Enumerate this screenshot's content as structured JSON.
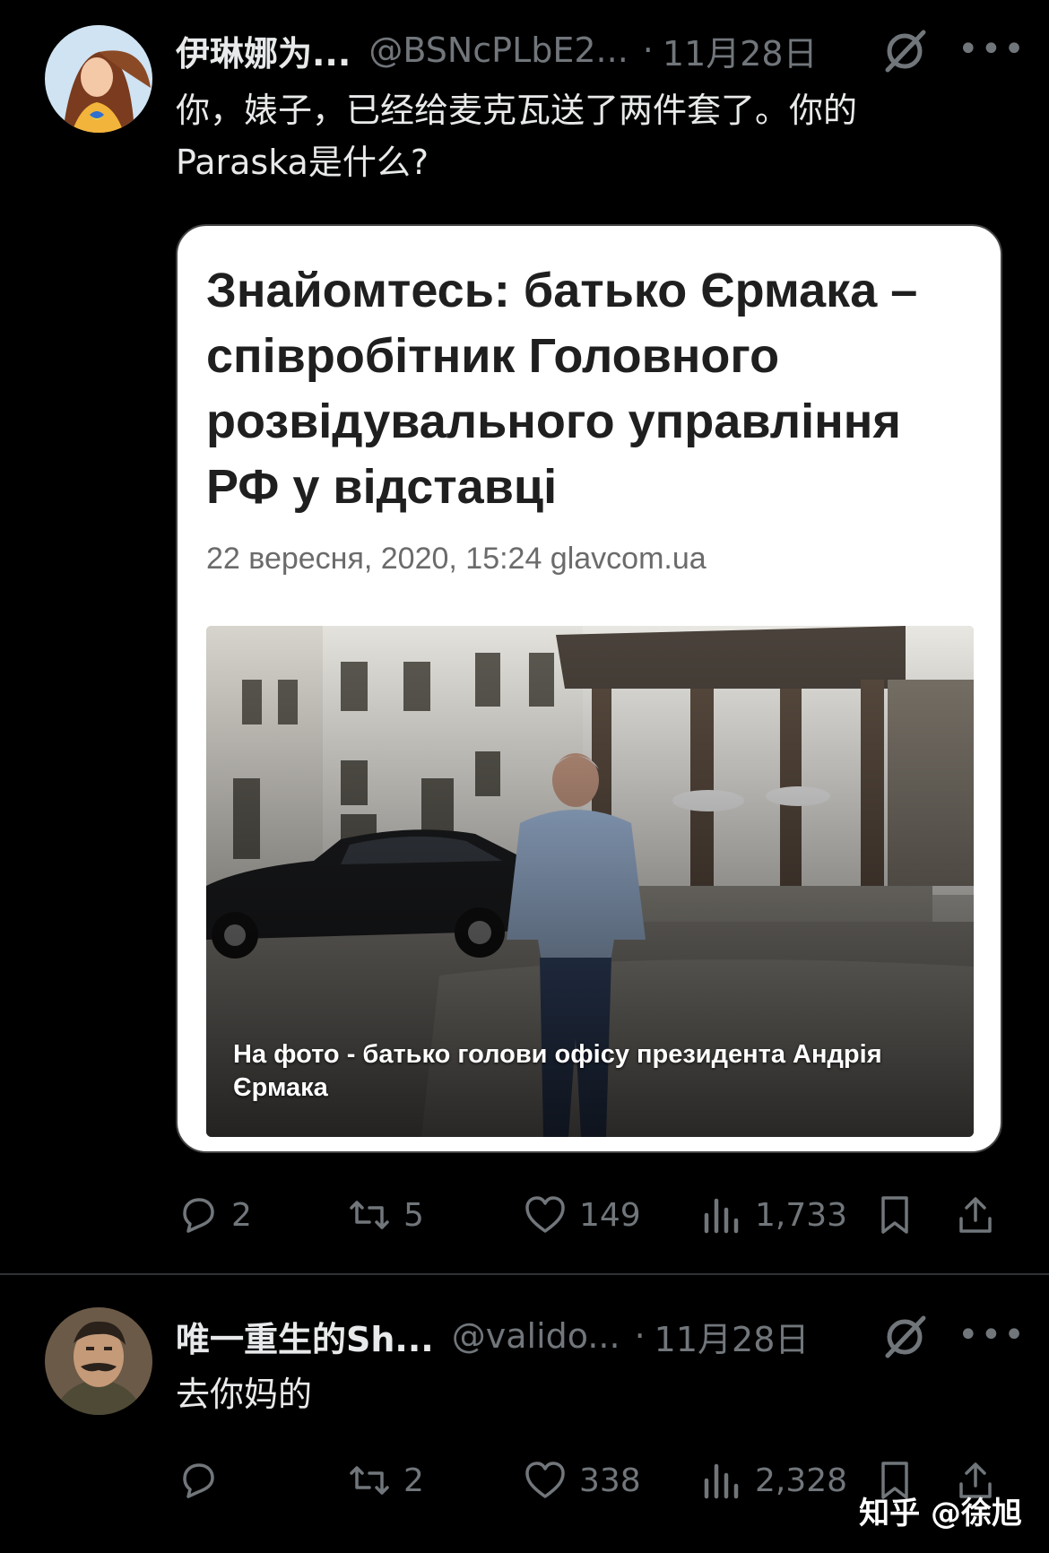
{
  "tweets": [
    {
      "name": "伊琳娜为...",
      "handle": "@BSNcPLbE2...",
      "separator": "·",
      "date": "11月28日",
      "more": "•••",
      "text_line1": "你，婊子，已经给麦克瓦送了两件套了。你的",
      "text_line2": "Paraska是什么?",
      "card": {
        "title": "Знайомтесь: батько Єрмака – співробітник Головного розвідувального управління РФ у відставці",
        "meta": "22 вересня, 2020, 15:24 glavcom.ua",
        "caption": "На фото - батько голови офісу президента Андрія Єрмака"
      },
      "stats": {
        "replies": "2",
        "reposts": "5",
        "likes": "149",
        "views": "1,733"
      }
    },
    {
      "name": "唯一重生的Sh...",
      "handle": "@valido...",
      "separator": "·",
      "date": "11月28日",
      "more": "•••",
      "text_line1": "去你妈的",
      "stats": {
        "replies": "",
        "reposts": "2",
        "likes": "338",
        "views": "2,328"
      }
    }
  ],
  "watermark": "知乎 @徐旭",
  "colors": {
    "background": "#000000",
    "text": "#e7e9ea",
    "muted": "#71767b",
    "divider": "#2f3336"
  }
}
